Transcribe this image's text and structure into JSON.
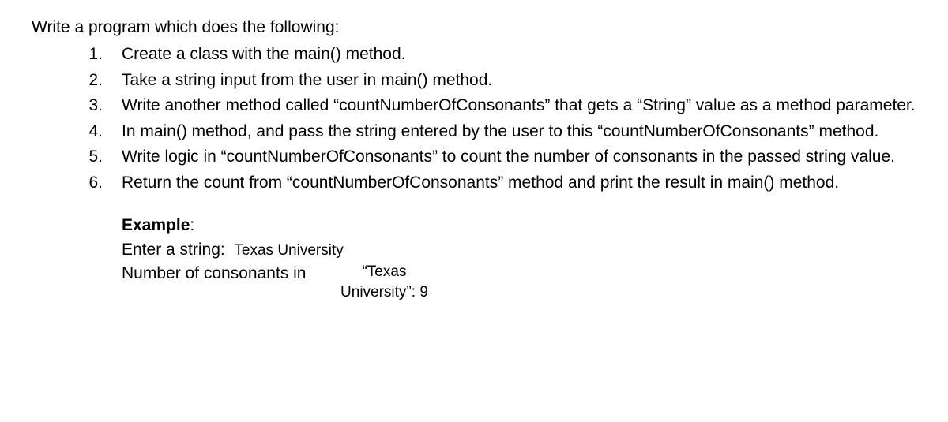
{
  "intro": "Write a program which does the following:",
  "items": [
    {
      "num": "1.",
      "text": "Create a class with the main() method."
    },
    {
      "num": "2.",
      "text": "Take a string input from the user in main() method."
    },
    {
      "num": "3.",
      "text": "Write another method called “countNumberOfConsonants” that gets a “String” value as a method parameter."
    },
    {
      "num": "4.",
      "text": "In main() method, and pass the string entered by the user to this “countNumberOfConsonants” method."
    },
    {
      "num": "5.",
      "text": "Write logic in “countNumberOfConsonants” to count the number of consonants in the passed string value."
    },
    {
      "num": "6.",
      "text": "Return the count from “countNumberOfConsonants” method and print the result in main() method."
    }
  ],
  "example": {
    "label": "Example",
    "colon": ":",
    "line1_prompt": "Enter a string:  ",
    "line1_value": "Texas University",
    "line2_prefix": "Number of consonants in",
    "line2_quoted": "“Texas University”: 9"
  }
}
